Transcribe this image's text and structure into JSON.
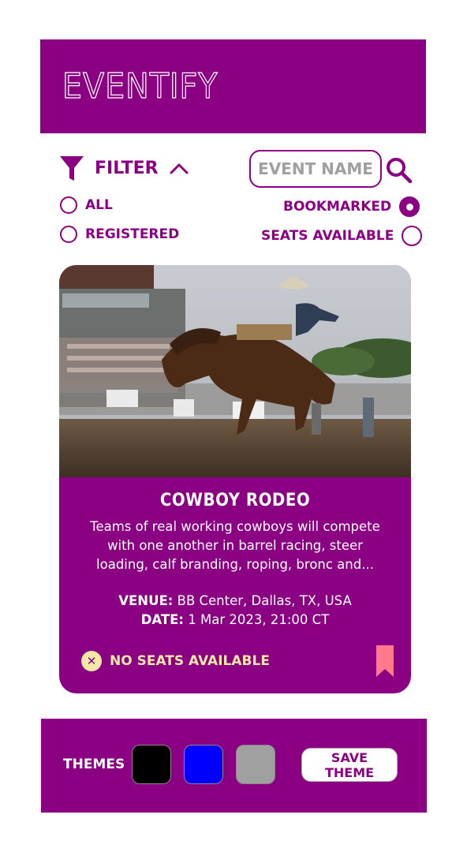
{
  "header": {
    "logo": "EVENTIFY"
  },
  "filter": {
    "label": "FILTER",
    "search_placeholder": "EVENT NAME",
    "options": [
      {
        "label": "ALL",
        "selected": false
      },
      {
        "label": "BOOKMARKED",
        "selected": true
      },
      {
        "label": "REGISTERED",
        "selected": false
      },
      {
        "label": "SEATS AVAILABLE",
        "selected": false
      }
    ]
  },
  "event": {
    "title": "COWBOY RODEO",
    "description": "Teams of real working cowboys will compete with one another in  barrel racing, steer loading, calf branding, roping, bronc and...",
    "venue_label": "VENUE:",
    "venue": "BB Center, Dallas, TX, USA",
    "date_label": "DATE:",
    "date": "1 Mar 2023, 21:00 CT",
    "status": "NO SEATS AVAILABLE",
    "bookmarked": true
  },
  "themes": {
    "label": "THEMES",
    "swatches": [
      "#000000",
      "#0000ff",
      "#a0a0a0"
    ],
    "save_label": "SAVE THEME"
  },
  "colors": {
    "primary": "#8b0083",
    "accent": "#f4e8a6",
    "bookmark": "#ff7a8a"
  }
}
